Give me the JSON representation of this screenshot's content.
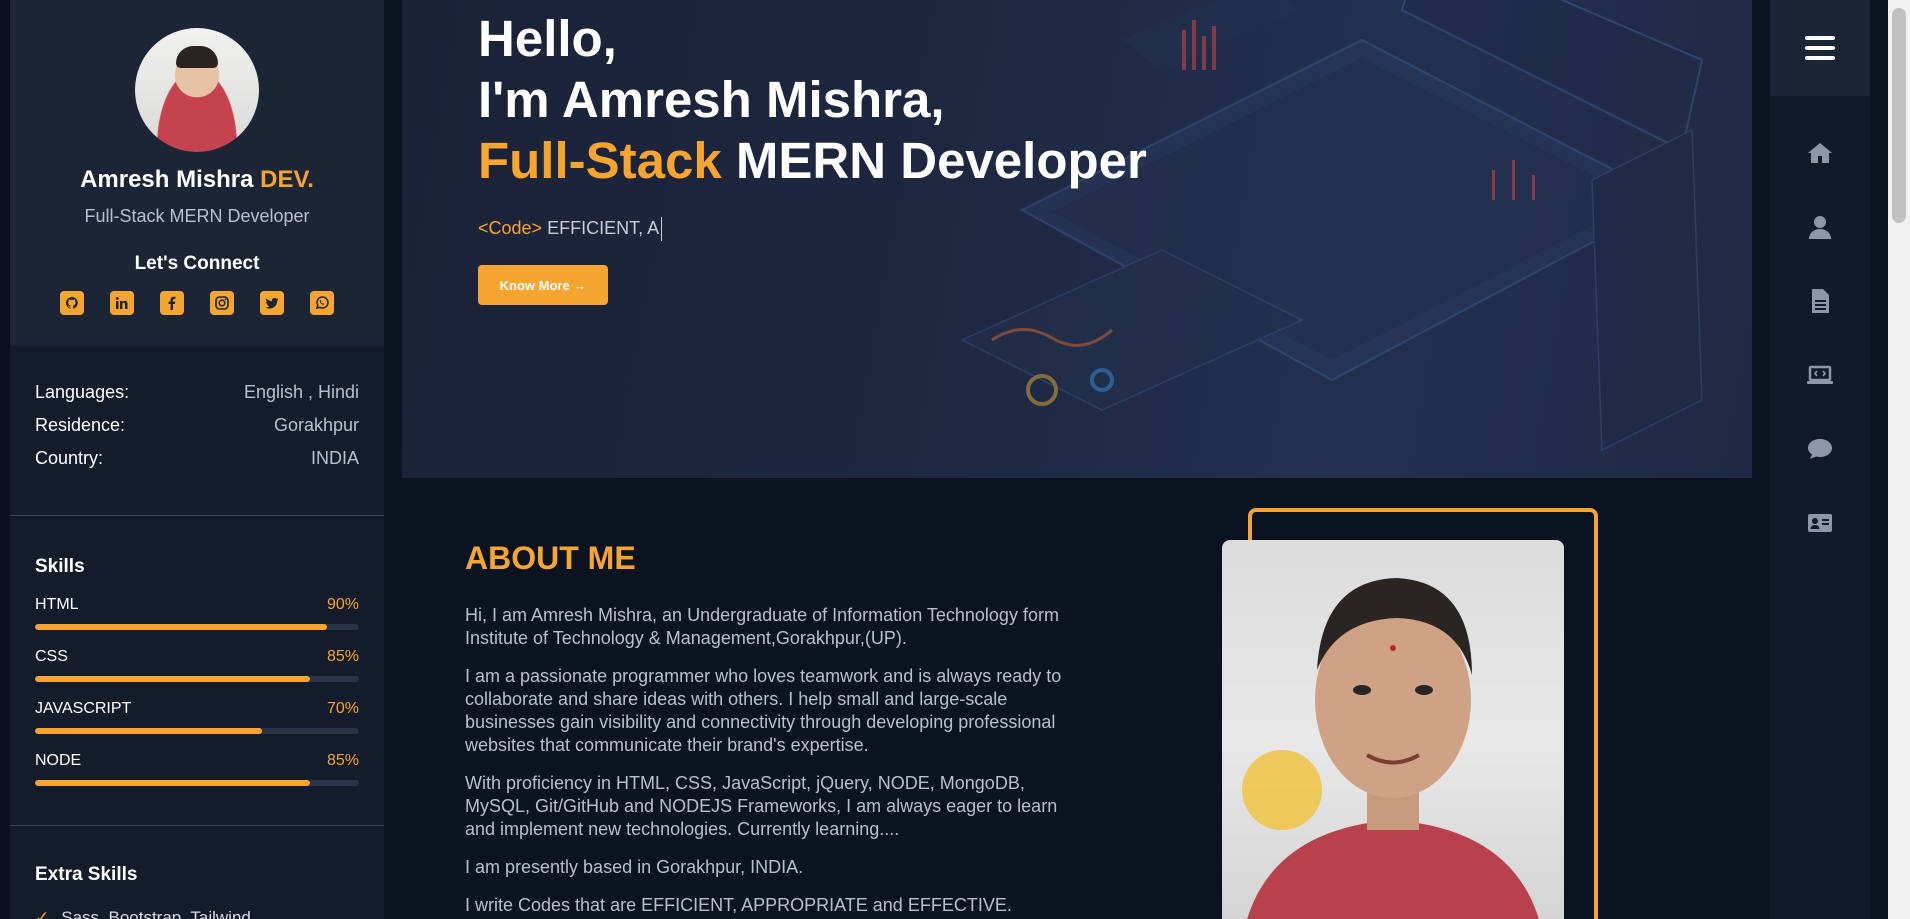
{
  "sidebar": {
    "name_main": "Amresh Mishra",
    "name_accent": "DEV.",
    "role": "Full-Stack MERN Developer",
    "connect_title": "Let's Connect",
    "socials": [
      "github-icon",
      "linkedin-icon",
      "facebook-icon",
      "instagram-icon",
      "twitter-icon",
      "whatsapp-icon"
    ],
    "info": [
      {
        "key": "Languages:",
        "value": "English , Hindi"
      },
      {
        "key": "Residence:",
        "value": "Gorakhpur"
      },
      {
        "key": "Country:",
        "value": "INDIA"
      }
    ],
    "skills_title": "Skills",
    "skills": [
      {
        "name": "HTML",
        "percent_label": "90%",
        "level": 0.9
      },
      {
        "name": "CSS",
        "percent_label": "85%",
        "level": 0.85
      },
      {
        "name": "JAVASCRIPT",
        "percent_label": "70%",
        "level": 0.7
      },
      {
        "name": "NODE",
        "percent_label": "85%",
        "level": 0.85
      }
    ],
    "extra_title": "Extra Skills",
    "extra_items": [
      "Sass, Bootstrap, Tailwind"
    ]
  },
  "hero": {
    "line1": "Hello,",
    "line2": "I'm Amresh Mishra,",
    "line3_accent": "Full-Stack",
    "line3_rest": "MERN Developer",
    "typing_code": "<Code>",
    "typing_text": "EFFICIENT, A",
    "button_label": "Know More →"
  },
  "about": {
    "title": "ABOUT ME",
    "paragraphs": [
      "Hi, I am Amresh Mishra, an Undergraduate of Information Technology form Institute of Technology & Management,Gorakhpur,(UP).",
      "I am a passionate programmer who loves teamwork and is always ready to collaborate and share ideas with others. I help small and large-scale businesses gain visibility and connectivity through developing professional websites that communicate their brand's expertise.",
      "With proficiency in HTML, CSS, JavaScript, jQuery, NODE, MongoDB, MySQL, Git/GitHub and NODEJS Frameworks, I am always eager to learn and implement new technologies. Currently learning....",
      "I am presently based in Gorakhpur, INDIA.",
      "I write Codes that are EFFICIENT, APPROPRIATE and EFFECTIVE."
    ]
  },
  "right_nav": {
    "menu_icon": "hamburger-menu-icon",
    "items": [
      "home-icon",
      "user-icon",
      "document-icon",
      "laptop-code-icon",
      "chat-icon",
      "contact-card-icon"
    ]
  },
  "colors": {
    "accent": "#f7a531",
    "background": "#0b1220",
    "sidebar": "#141c2b"
  }
}
